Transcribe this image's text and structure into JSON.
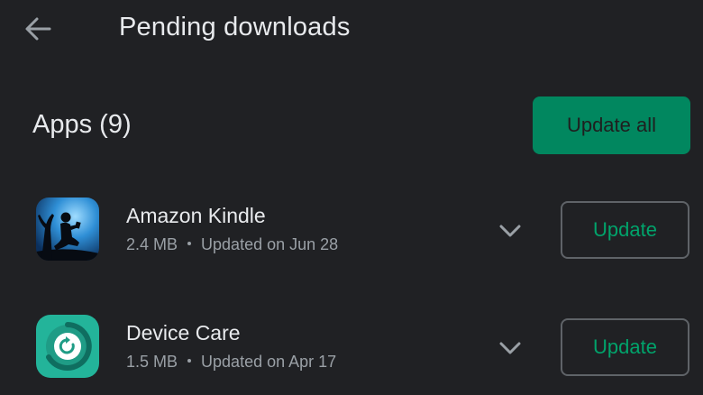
{
  "header": {
    "title": "Pending downloads",
    "back_icon": "arrow-back-icon"
  },
  "section": {
    "title": "Apps (9)",
    "update_all_label": "Update all"
  },
  "apps": [
    {
      "name": "Amazon Kindle",
      "size": "2.4 MB",
      "updated": "Updated on Jun 28",
      "icon": "kindle-app-icon",
      "update_label": "Update"
    },
    {
      "name": "Device Care",
      "size": "1.5 MB",
      "updated": "Updated on Apr 17",
      "icon": "device-care-app-icon",
      "update_label": "Update"
    }
  ],
  "colors": {
    "background": "#202124",
    "accent": "#01875f",
    "accent_text": "#01a36b",
    "primary_text": "#e8eaed",
    "secondary_text": "#9aa0a6"
  }
}
